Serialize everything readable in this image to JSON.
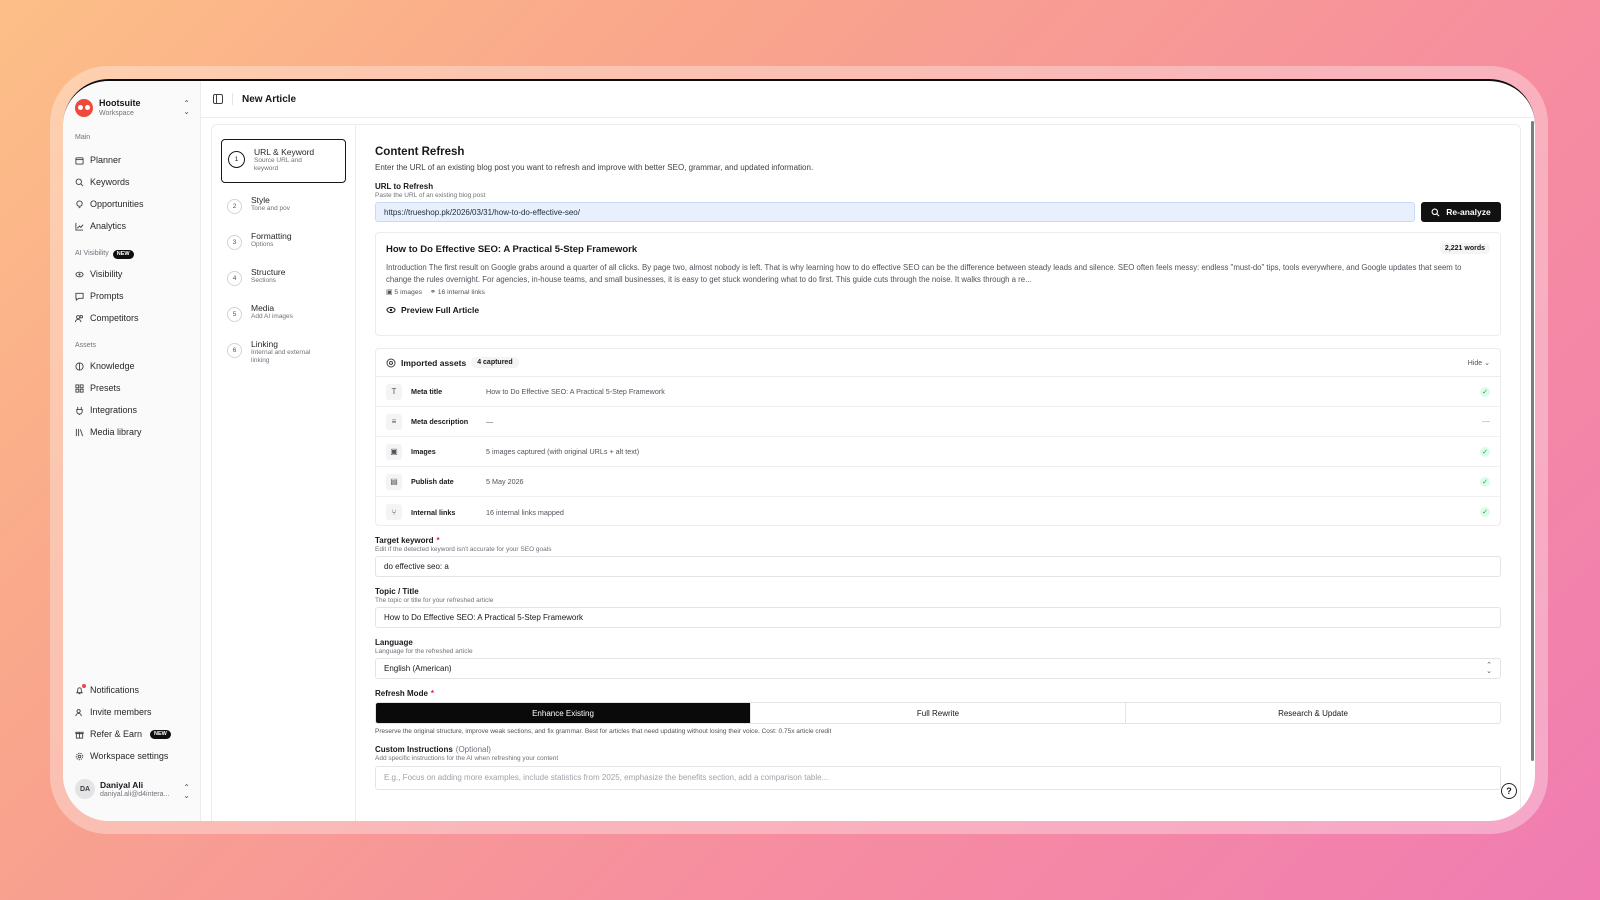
{
  "workspace": {
    "name": "Hootsuite",
    "sub": "Workspace"
  },
  "sidebar": {
    "main_label": "Main",
    "main_items": [
      {
        "label": "Planner",
        "icon": "calendar-icon"
      },
      {
        "label": "Keywords",
        "icon": "search-icon"
      },
      {
        "label": "Opportunities",
        "icon": "lightbulb-icon"
      },
      {
        "label": "Analytics",
        "icon": "chart-icon"
      }
    ],
    "ai_label": "AI Visibility",
    "ai_badge": "NEW",
    "ai_items": [
      {
        "label": "Visibility",
        "icon": "eye-icon"
      },
      {
        "label": "Prompts",
        "icon": "message-icon"
      },
      {
        "label": "Competitors",
        "icon": "users-icon"
      }
    ],
    "assets_label": "Assets",
    "asset_items": [
      {
        "label": "Knowledge",
        "icon": "globe-icon"
      },
      {
        "label": "Presets",
        "icon": "grid-icon"
      },
      {
        "label": "Integrations",
        "icon": "plug-icon"
      },
      {
        "label": "Media library",
        "icon": "library-icon"
      }
    ],
    "bottom_items": [
      {
        "label": "Notifications",
        "icon": "bell-icon"
      },
      {
        "label": "Invite members",
        "icon": "user-plus-icon"
      },
      {
        "label": "Refer & Earn",
        "icon": "gift-icon",
        "badge": "NEW"
      },
      {
        "label": "Workspace settings",
        "icon": "gear-icon"
      }
    ],
    "user": {
      "initials": "DA",
      "name": "Daniyal Ali",
      "email": "daniyal.ali@d4intera..."
    }
  },
  "header": {
    "title": "New Article"
  },
  "steps": [
    {
      "num": "1",
      "title": "URL & Keyword",
      "desc": "Source URL and keyword"
    },
    {
      "num": "2",
      "title": "Style",
      "desc": "Tone and pov"
    },
    {
      "num": "3",
      "title": "Formatting",
      "desc": "Options"
    },
    {
      "num": "4",
      "title": "Structure",
      "desc": "Sections"
    },
    {
      "num": "5",
      "title": "Media",
      "desc": "Add AI images"
    },
    {
      "num": "6",
      "title": "Linking",
      "desc": "Internal and external linking"
    }
  ],
  "form": {
    "title": "Content Refresh",
    "lead": "Enter the URL of an existing blog post you want to refresh and improve with better SEO, grammar, and updated information.",
    "url_label": "URL to Refresh",
    "url_hint": "Paste the URL of an existing blog post",
    "url_value": "https://trueshop.pk/2026/03/31/how-to-do-effective-seo/",
    "reanalyze": "Re-analyze",
    "article": {
      "title": "How to Do Effective SEO: A Practical 5-Step Framework",
      "words": "2,221 words",
      "body": "Introduction The first result on Google grabs around a quarter of all clicks. By page two, almost nobody is left. That is why learning how to do effective SEO can be the difference between steady leads and silence. SEO often feels messy: endless \"must-do\" tips, tools everywhere, and Google updates that seem to change the rules overnight. For agencies, in-house teams, and small businesses, it is easy to get stuck wondering what to do first. This guide cuts through the noise. It walks through a re...",
      "images": "5 images",
      "links": "16 internal links",
      "preview": "Preview Full Article"
    },
    "assets": {
      "title": "Imported assets",
      "captured": "4 captured",
      "hide": "Hide",
      "rows": [
        {
          "icon": "T",
          "name": "Meta title",
          "value": "How to Do Effective SEO: A Practical 5-Step Framework",
          "status": "ok"
        },
        {
          "icon": "≡",
          "name": "Meta description",
          "value": "—",
          "status": "none"
        },
        {
          "icon": "▣",
          "name": "Images",
          "value": "5 images captured (with original URLs + alt text)",
          "status": "ok"
        },
        {
          "icon": "▤",
          "name": "Publish date",
          "value": "5 May 2026",
          "status": "ok"
        },
        {
          "icon": "⑂",
          "name": "Internal links",
          "value": "16 internal links mapped",
          "status": "ok"
        }
      ]
    },
    "keyword_label": "Target keyword",
    "keyword_hint": "Edit if the detected keyword isn't accurate for your SEO goals",
    "keyword_value": "do effective seo: a",
    "topic_label": "Topic / Title",
    "topic_hint": "The topic or title for your refreshed article",
    "topic_value": "How to Do Effective SEO: A Practical 5-Step Framework",
    "language_label": "Language",
    "language_hint": "Language for the refreshed article",
    "language_value": "English (American)",
    "mode_label": "Refresh Mode",
    "modes": [
      "Enhance Existing",
      "Full Rewrite",
      "Research & Update"
    ],
    "mode_note": "Preserve the original structure, improve weak sections, and fix grammar. Best for articles that need updating without losing their voice. Cost: 0.75x article credit",
    "custom_label": "Custom Instructions",
    "custom_optional": "(Optional)",
    "custom_hint": "Add specific instructions for the AI when refreshing your content",
    "custom_placeholder": "E.g., Focus on adding more examples, include statistics from 2025, emphasize the benefits section, add a comparison table..."
  },
  "colors": {
    "accent": "#111111",
    "success": "#16a34a",
    "url_bg": "#e8f0fd"
  }
}
